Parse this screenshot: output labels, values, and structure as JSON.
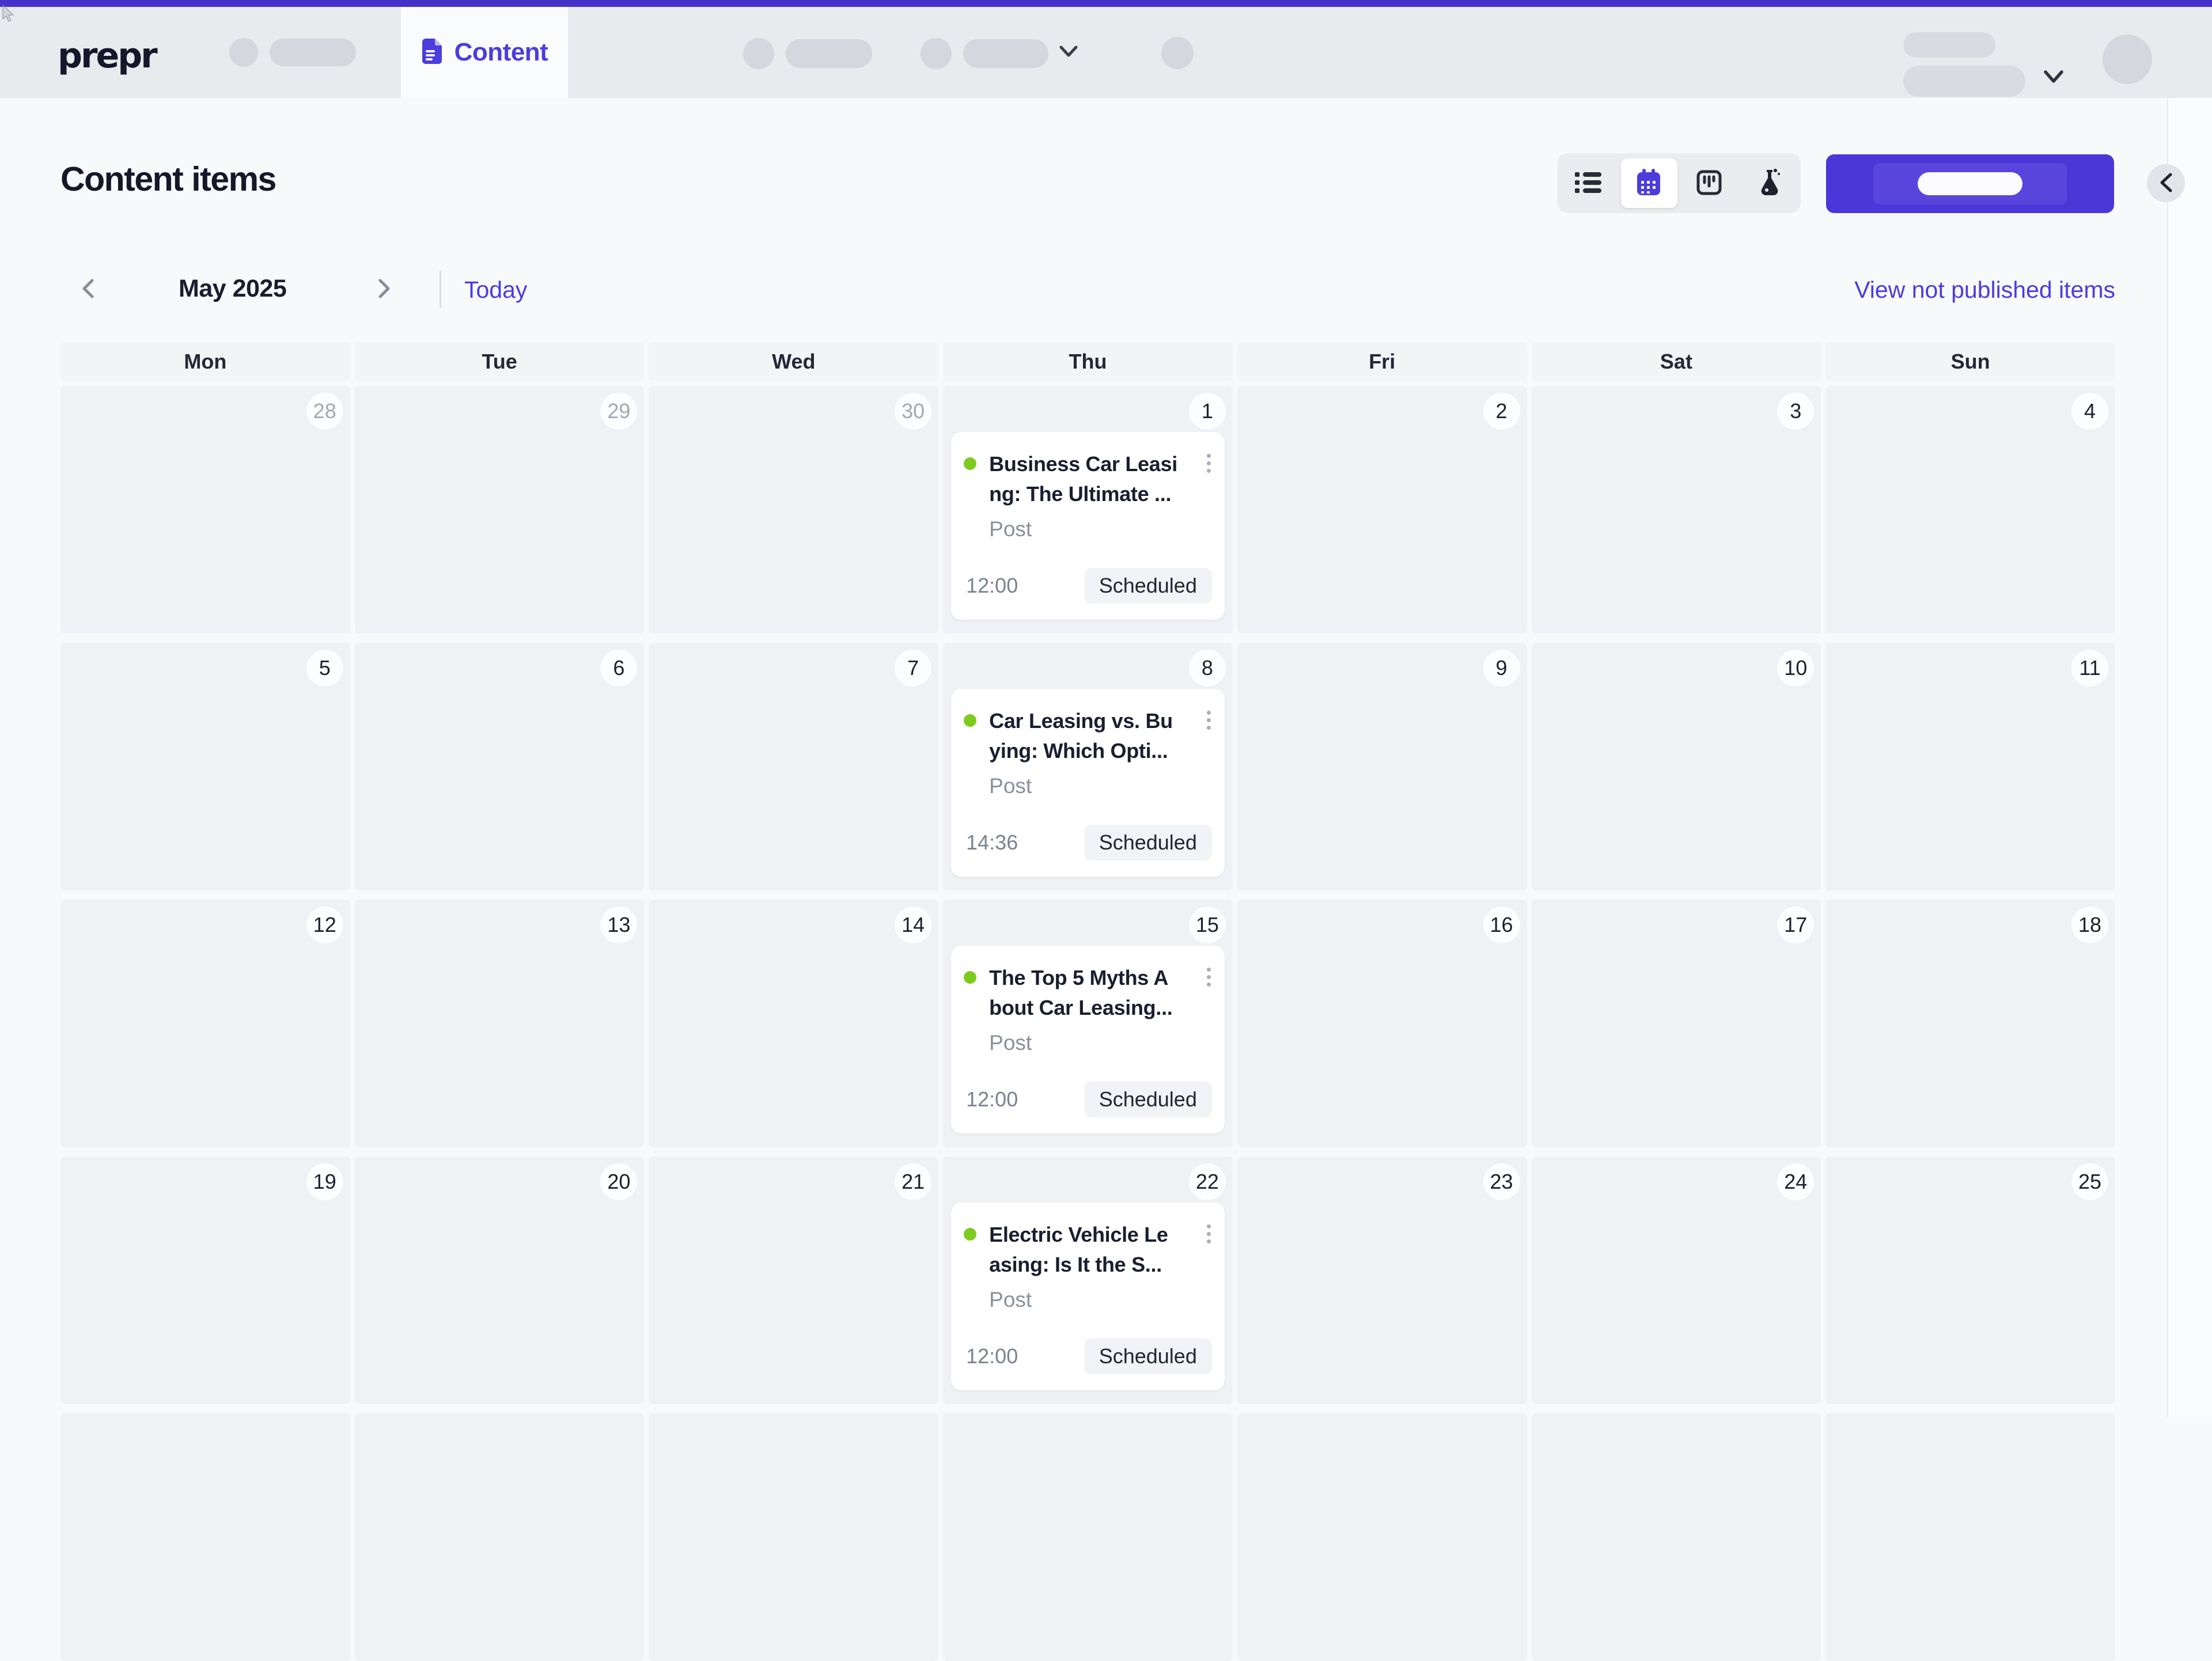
{
  "topbar": {
    "logo": "prepr",
    "content_tab": "Content"
  },
  "page_title": "Content items",
  "toolbar": {
    "view_buttons": [
      {
        "name": "list-view",
        "active": false
      },
      {
        "name": "calendar-view",
        "active": true
      },
      {
        "name": "board-view",
        "active": false
      },
      {
        "name": "experiments-view",
        "active": false
      }
    ]
  },
  "month_nav": {
    "label": "May 2025",
    "today_label": "Today",
    "not_published_link": "View not published items"
  },
  "calendar": {
    "day_headers": [
      "Mon",
      "Tue",
      "Wed",
      "Thu",
      "Fri",
      "Sat",
      "Sun"
    ],
    "weeks": [
      [
        {
          "date": "28",
          "muted": true
        },
        {
          "date": "29",
          "muted": true
        },
        {
          "date": "30",
          "muted": true
        },
        {
          "date": "1",
          "muted": false,
          "event": {
            "title_line1": "Business Car Leasi",
            "title_line2": "ng: The Ultimate ...",
            "type": "Post",
            "time": "12:00",
            "status": "Scheduled",
            "dot_color": "#7ECB20"
          }
        },
        {
          "date": "2",
          "muted": false
        },
        {
          "date": "3",
          "muted": false
        },
        {
          "date": "4",
          "muted": false
        }
      ],
      [
        {
          "date": "5",
          "muted": false
        },
        {
          "date": "6",
          "muted": false
        },
        {
          "date": "7",
          "muted": false
        },
        {
          "date": "8",
          "muted": false,
          "event": {
            "title_line1": "Car Leasing vs. Bu",
            "title_line2": "ying: Which Opti...",
            "type": "Post",
            "time": "14:36",
            "status": "Scheduled",
            "dot_color": "#7ECB20"
          }
        },
        {
          "date": "9",
          "muted": false
        },
        {
          "date": "10",
          "muted": false
        },
        {
          "date": "11",
          "muted": false
        }
      ],
      [
        {
          "date": "12",
          "muted": false
        },
        {
          "date": "13",
          "muted": false
        },
        {
          "date": "14",
          "muted": false
        },
        {
          "date": "15",
          "muted": false,
          "event": {
            "title_line1": "The Top 5 Myths A",
            "title_line2": "bout Car Leasing...",
            "type": "Post",
            "time": "12:00",
            "status": "Scheduled",
            "dot_color": "#7ECB20"
          }
        },
        {
          "date": "16",
          "muted": false
        },
        {
          "date": "17",
          "muted": false
        },
        {
          "date": "18",
          "muted": false
        }
      ],
      [
        {
          "date": "19",
          "muted": false
        },
        {
          "date": "20",
          "muted": false
        },
        {
          "date": "21",
          "muted": false
        },
        {
          "date": "22",
          "muted": false,
          "event": {
            "title_line1": "Electric Vehicle Le",
            "title_line2": "asing: Is It the S...",
            "type": "Post",
            "time": "12:00",
            "status": "Scheduled",
            "dot_color": "#7ECB20"
          }
        },
        {
          "date": "23",
          "muted": false
        },
        {
          "date": "24",
          "muted": false
        },
        {
          "date": "25",
          "muted": false
        }
      ]
    ]
  },
  "colors": {
    "accent": "#4C3DDC",
    "top_strip": "#4533C9",
    "primary_button": "#4B36D8",
    "link": "#4C3BE0",
    "event_dot": "#7ECB20",
    "navbar_bg": "#E9EAED",
    "cell_bg": "#F0F1F4"
  }
}
